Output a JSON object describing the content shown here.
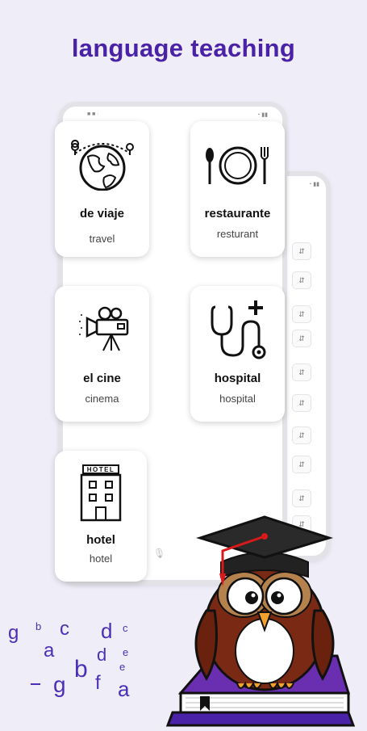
{
  "header": {
    "title": "language teaching"
  },
  "cards": [
    {
      "id": "travel",
      "spanish": "de viaje",
      "english": "travel",
      "icon": "globe-travel-icon"
    },
    {
      "id": "restaurant",
      "spanish": "restaurante",
      "english": "resturant",
      "icon": "plate-cutlery-icon"
    },
    {
      "id": "cinema",
      "spanish": "el cine",
      "english": "cinema",
      "icon": "movie-camera-icon"
    },
    {
      "id": "hospital",
      "spanish": "hospital",
      "english": "hospital",
      "icon": "stethoscope-icon"
    },
    {
      "id": "hotel",
      "spanish": "hotel",
      "english": "hotel",
      "icon": "hotel-building-icon",
      "sign": "HOTEL"
    }
  ],
  "decor": {
    "letters": [
      "g",
      "b",
      "a",
      "c",
      "d",
      "c",
      "d",
      "e",
      "e",
      "b",
      "g",
      "f",
      "a"
    ],
    "mascot": "owl-graduate-icon",
    "colors": {
      "accent": "#4a22a8",
      "letters": "#4b2fb8",
      "background": "#efedf7"
    }
  }
}
